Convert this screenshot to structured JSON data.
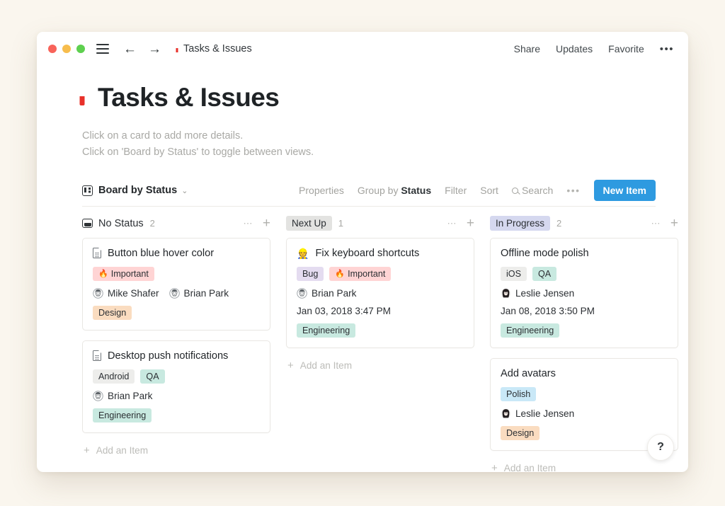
{
  "titlebar": {
    "breadcrumb_title": "Tasks & Issues",
    "breadcrumb_icon": "mailbox-icon",
    "menu_icon": "hamburger-menu-icon",
    "back_icon": "arrow-left-icon",
    "forward_icon": "arrow-right-icon",
    "share_label": "Share",
    "updates_label": "Updates",
    "favorite_label": "Favorite",
    "more_label": "•••"
  },
  "page": {
    "title": "Tasks & Issues",
    "title_icon": "mailbox-icon",
    "description_line1": "Click on a card to add more details.",
    "description_line2": "Click on 'Board by Status' to toggle between views."
  },
  "toolbar": {
    "view_icon": "board-view-icon",
    "view_name": "Board by Status",
    "caret": "⌄",
    "properties_label": "Properties",
    "group_by_prefix": "Group by ",
    "group_by_value": "Status",
    "filter_label": "Filter",
    "sort_label": "Sort",
    "search_label": "Search",
    "search_icon": "search-icon",
    "more_label": "•••",
    "new_item_label": "New Item",
    "new_item_color": "#2e9ae0"
  },
  "columns": [
    {
      "name": "No Status",
      "icon": "inbox-icon",
      "pill": false,
      "pill_bg": "",
      "count": "2",
      "add_label": "Add an Item",
      "cards": [
        {
          "title": "Button blue hover color",
          "icon": "document-icon",
          "icon_type": "doc",
          "tags": [
            {
              "label": "Important",
              "emoji": "🔥",
              "bg": "#ffd4d4"
            }
          ],
          "people": [
            {
              "name": "Mike Shafer",
              "avatar": "face-avatar"
            },
            {
              "name": "Brian Park",
              "avatar": "face-avatar"
            }
          ],
          "date": "",
          "footer_tags": [
            {
              "label": "Design",
              "bg": "#fadcc0"
            }
          ]
        },
        {
          "title": "Desktop push notifications",
          "icon": "document-icon",
          "icon_type": "doc",
          "tags": [
            {
              "label": "Android",
              "emoji": "",
              "bg": "#ededeb"
            },
            {
              "label": "QA",
              "emoji": "",
              "bg": "#c8e9e0"
            }
          ],
          "people": [
            {
              "name": "Brian Park",
              "avatar": "face-avatar"
            }
          ],
          "date": "",
          "footer_tags": [
            {
              "label": "Engineering",
              "bg": "#c8e9e0"
            }
          ]
        }
      ]
    },
    {
      "name": "Next Up",
      "icon": "",
      "pill": true,
      "pill_bg": "#e3e3e1",
      "count": "1",
      "add_label": "Add an Item",
      "cards": [
        {
          "title": "Fix keyboard shortcuts",
          "icon": "construction-worker-icon",
          "icon_type": "emoji",
          "icon_emoji": "👷",
          "tags": [
            {
              "label": "Bug",
              "emoji": "",
              "bg": "#e4dcf0"
            },
            {
              "label": "Important",
              "emoji": "🔥",
              "bg": "#ffd4d4"
            }
          ],
          "people": [
            {
              "name": "Brian Park",
              "avatar": "face-avatar"
            }
          ],
          "date": "Jan 03, 2018 3:47 PM",
          "footer_tags": [
            {
              "label": "Engineering",
              "bg": "#c8e9e0"
            }
          ]
        }
      ]
    },
    {
      "name": "In Progress",
      "icon": "",
      "pill": true,
      "pill_bg": "#d5d8ef",
      "count": "2",
      "add_label": "Add an Item",
      "cards": [
        {
          "title": "Offline mode polish",
          "icon": "",
          "icon_type": "none",
          "tags": [
            {
              "label": "iOS",
              "emoji": "",
              "bg": "#ededeb"
            },
            {
              "label": "QA",
              "emoji": "",
              "bg": "#c8e9e0"
            }
          ],
          "people": [
            {
              "name": "Leslie Jensen",
              "avatar": "woman-avatar"
            }
          ],
          "date": "Jan 08, 2018 3:50 PM",
          "footer_tags": [
            {
              "label": "Engineering",
              "bg": "#c8e9e0"
            }
          ]
        },
        {
          "title": "Add avatars",
          "icon": "",
          "icon_type": "none",
          "tags": [
            {
              "label": "Polish",
              "emoji": "",
              "bg": "#c9e8f7"
            }
          ],
          "people": [
            {
              "name": "Leslie Jensen",
              "avatar": "woman-avatar"
            }
          ],
          "date": "",
          "footer_tags": [
            {
              "label": "Design",
              "bg": "#fadcc0"
            }
          ]
        }
      ]
    },
    {
      "name": "",
      "icon": "",
      "pill": true,
      "pill_bg": "#e5d4ee",
      "count": "",
      "add_label": "",
      "cards": [
        {
          "title": "",
          "icon": "",
          "icon_type": "none",
          "tags": [],
          "people": [],
          "date": "",
          "footer_tags": []
        }
      ]
    }
  ],
  "help": {
    "label": "?"
  }
}
